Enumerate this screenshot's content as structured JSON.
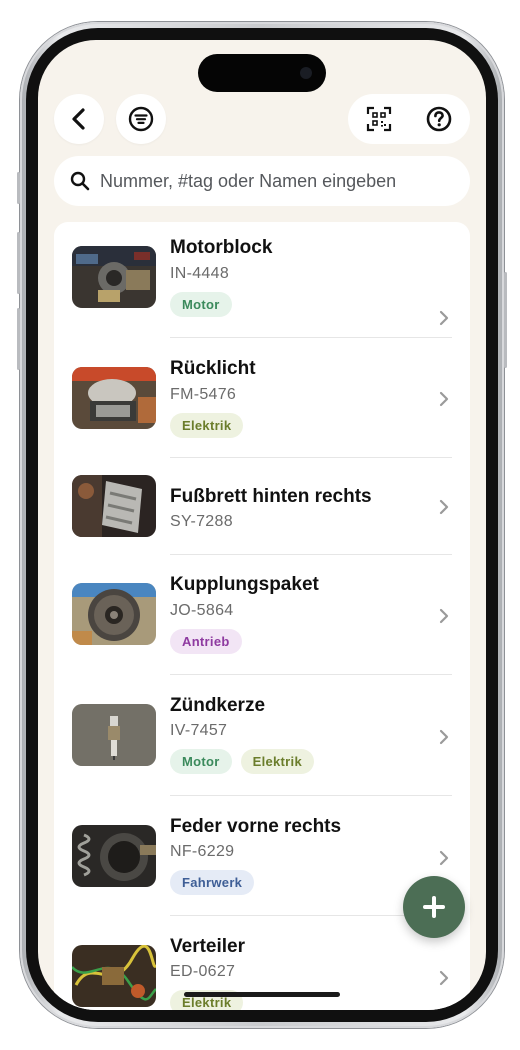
{
  "header": {
    "back_icon": "chevron-left-icon",
    "filter_icon": "filter-list-icon",
    "scan_icon": "qr-scan-icon",
    "help_icon": "question-circle-icon"
  },
  "search": {
    "placeholder": "Nummer, #tag oder Namen eingeben",
    "icon": "search-icon"
  },
  "items": [
    {
      "name": "Motorblock",
      "code": "IN-4448",
      "tags": [
        {
          "label": "Motor",
          "type": "motor"
        }
      ]
    },
    {
      "name": "Rücklicht",
      "code": "FM-5476",
      "tags": [
        {
          "label": "Elektrik",
          "type": "elektrik"
        }
      ]
    },
    {
      "name": "Fußbrett hinten rechts",
      "code": "SY-7288",
      "tags": []
    },
    {
      "name": "Kupplungspaket",
      "code": "JO-5864",
      "tags": [
        {
          "label": "Antrieb",
          "type": "antrieb"
        }
      ]
    },
    {
      "name": "Zündkerze",
      "code": "IV-7457",
      "tags": [
        {
          "label": "Motor",
          "type": "motor"
        },
        {
          "label": "Elektrik",
          "type": "elektrik"
        }
      ]
    },
    {
      "name": "Feder vorne rechts",
      "code": "NF-6229",
      "tags": [
        {
          "label": "Fahrwerk",
          "type": "fahrwerk"
        }
      ]
    },
    {
      "name": "Verteiler",
      "code": "ED-0627",
      "tags": [
        {
          "label": "Elektrik",
          "type": "elektrik"
        }
      ]
    }
  ],
  "fab": {
    "icon": "plus-icon"
  },
  "colors": {
    "background": "#f7f3ec",
    "accent": "#4c6e55",
    "tag_motor": "#3b8a5c",
    "tag_elektrik": "#6b7d2b",
    "tag_antrieb": "#8e3aa0",
    "tag_fahrwerk": "#3e5e96"
  }
}
